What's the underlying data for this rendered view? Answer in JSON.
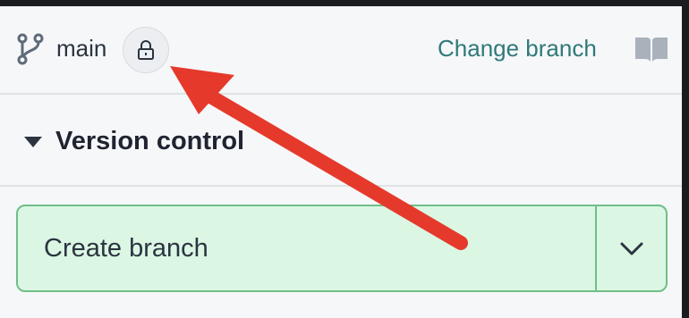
{
  "branch": {
    "name": "main",
    "branch_icon": "git-branch-icon",
    "lock_icon": "lock-icon",
    "change_label": "Change branch",
    "docs_icon": "book-icon"
  },
  "section": {
    "caret_icon": "caret-down-icon",
    "title": "Version control"
  },
  "create": {
    "label": "Create branch",
    "dropdown_icon": "chevron-down-icon"
  },
  "annotation": {
    "type": "arrow",
    "color": "#e53a2b",
    "points_to": "lock-button"
  },
  "colors": {
    "accent_link": "#2e7a78",
    "button_bg": "#dbf7e4",
    "button_border": "#6fbf87",
    "background": "#f6f7f9"
  }
}
